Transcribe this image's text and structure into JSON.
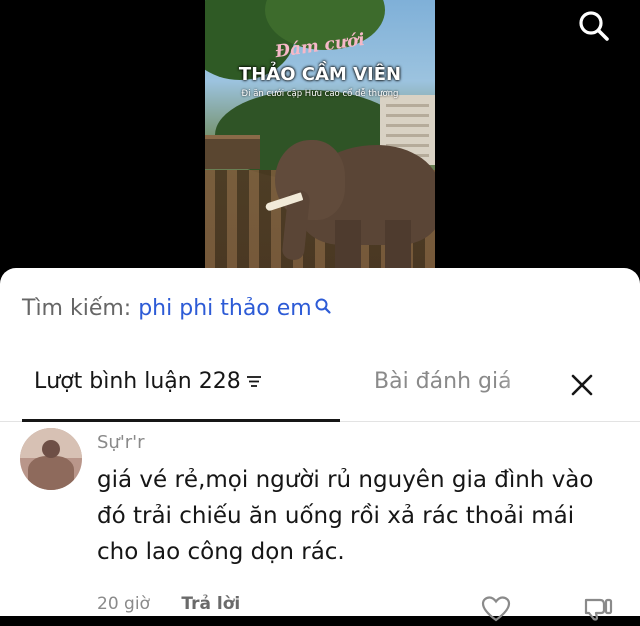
{
  "video": {
    "title_line1": "Đám cưới",
    "title_line2": "THẢO CẦM VIÊN",
    "subtitle": "Đi ăn cưới cặp Hưu cao cổ dễ thương"
  },
  "search": {
    "label": "Tìm kiếm:",
    "term": "phi phi thảo em"
  },
  "tabs": {
    "comments_label": "Lượt bình luận",
    "comments_count": "228",
    "reviews_label": "Bài đánh giá"
  },
  "comment": {
    "username": "Sự'r'r",
    "text": "giá vé rẻ,mọi người rủ nguyên gia đình vào đó trải chiếu ăn uống rồi xả rác thoải mái cho lao công dọn rác.",
    "time": "20 giờ",
    "reply_label": "Trả lời"
  },
  "icons": {
    "top_search": "search-icon",
    "inline_search": "search-icon",
    "sort": "filter-icon",
    "close": "close-icon",
    "like": "heart-icon",
    "dislike": "dislike-icon"
  },
  "colors": {
    "search_term": "#2d5bd6",
    "sheet_bg": "#ffffff",
    "muted_text": "#8a8a8a"
  }
}
